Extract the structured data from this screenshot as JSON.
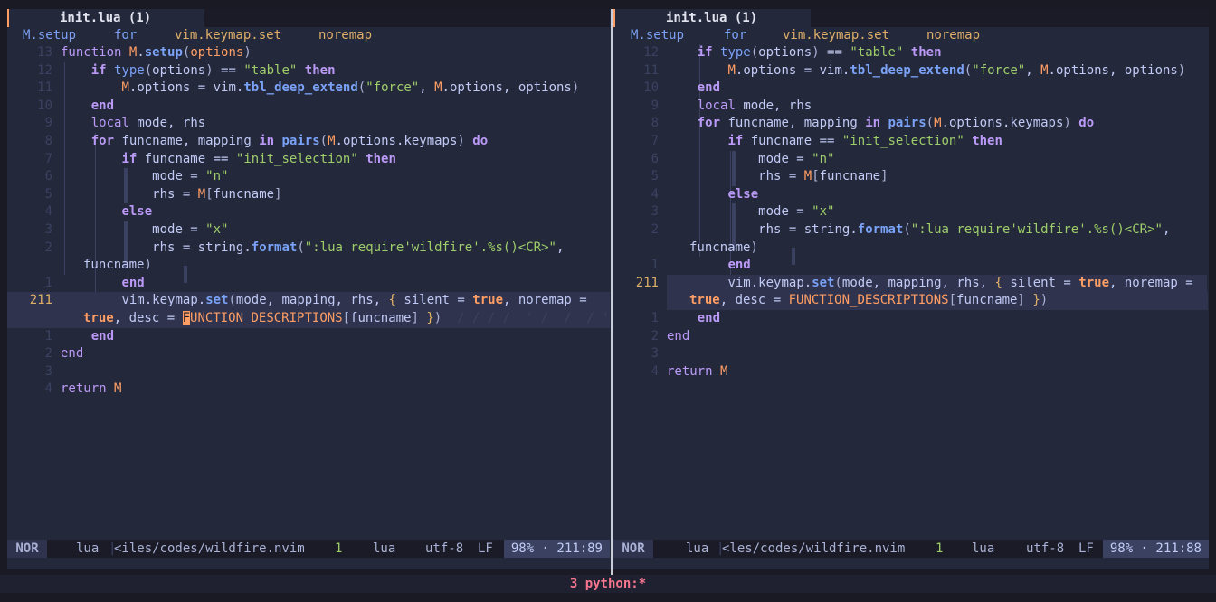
{
  "left": {
    "tab_title": "init.lua (1)",
    "winbar": [
      "M.setup",
      "for",
      "vim.keymap.set",
      "noremap"
    ],
    "status": {
      "mode": "NOR",
      "filetype": "lua",
      "path": "<iles/codes/wildfire.nvim",
      "count": "1",
      "ft2": "lua",
      "encoding": "utf-8",
      "eol": "LF",
      "position": "98% · 211:89"
    }
  },
  "right": {
    "tab_title": "init.lua (1)",
    "winbar": [
      "M.setup",
      "for",
      "vim.keymap.set",
      "noremap"
    ],
    "status": {
      "mode": "NOR",
      "filetype": "lua",
      "path": "<les/codes/wildfire.nvim",
      "count": "1",
      "ft2": "lua",
      "encoding": "utf-8",
      "eol": "LF",
      "position": "98% · 211:88"
    }
  },
  "tmux": {
    "window": "3 python:*"
  },
  "code": {
    "l13": "13",
    "l12": "12",
    "l11": "11",
    "l10": "10",
    "l9": "9",
    "l8": "8",
    "l7": "7",
    "l6": "6",
    "l5": "5",
    "l4": "4",
    "l3": "3",
    "l2": "2",
    "l1": "1",
    "l211": "211",
    "kw_function": "function",
    "kw_if": "if",
    "kw_then": "then",
    "kw_end": "end",
    "kw_local": "local",
    "kw_for": "for",
    "kw_in": "in",
    "kw_do": "do",
    "kw_else": "else",
    "kw_return": "return",
    "kw_true": "true",
    "fn_setup": "setup",
    "fn_type": "type",
    "fn_tbl": "tbl_deep_extend",
    "fn_pairs": "pairs",
    "fn_format": "format",
    "fn_set": "set",
    "str_table": "\"table\"",
    "str_force": "\"force\"",
    "str_init": "\"init_selection\"",
    "str_n": "\"n\"",
    "str_x": "\"x\"",
    "str_lua": "\":lua require'wildfire'.%s()<CR>\"",
    "m": "M",
    "options": "options",
    "mode": "mode",
    "rhs": "rhs",
    "funcname": "funcname",
    "mapping": "mapping",
    "string": "string",
    "vim": "vim",
    "keymap": "keymap",
    "silent": "silent",
    "noremap": "noremap",
    "desc": "desc",
    "func_desc": "FUNCTION_DESCRIPTIONS",
    "func_desc_rest": "UNCTION_DESCRIPTIONS",
    "cursor_char": "F",
    "ghost": "/ / / /  ' /  /  / '  / "
  }
}
